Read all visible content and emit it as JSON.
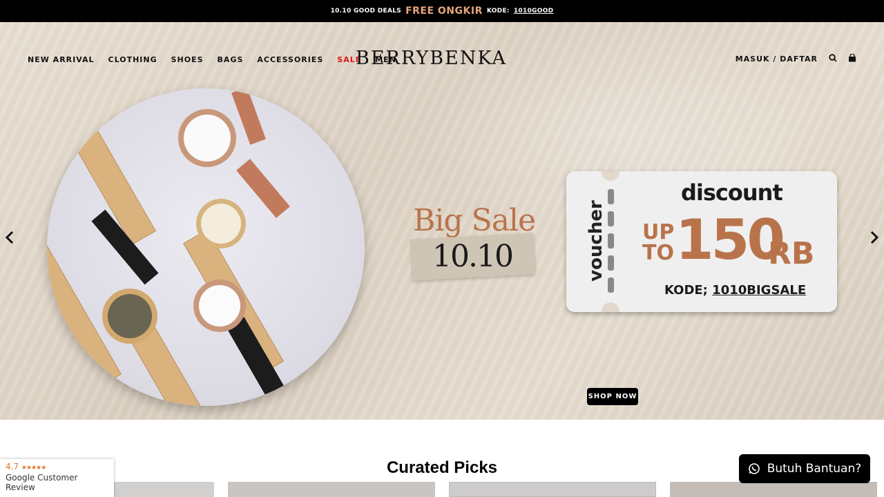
{
  "topbar": {
    "deals": "10.10 GOOD DEALS",
    "free": "FREE ONGKIR",
    "kode_label": "KODE:",
    "kode": "1010GOOD"
  },
  "nav": {
    "items": [
      "NEW ARRIVAL",
      "CLOTHING",
      "SHOES",
      "BAGS",
      "ACCESSORIES",
      "SALE",
      "MEN"
    ]
  },
  "logo": "BERRYBENKA",
  "account": {
    "login": "MASUK / DAFTAR"
  },
  "hero": {
    "big_sale": "Big Sale",
    "date": "10.10",
    "voucher": {
      "label": "voucher",
      "discount": "discount",
      "upto": "UP TO",
      "amount": "150",
      "unit": "RB",
      "kode_label": "KODE;",
      "kode": "1010BIGSALE"
    },
    "cta": "SHOP NOW"
  },
  "section": {
    "title": "Curated Picks"
  },
  "review": {
    "rating": "4.7",
    "stars": "★★★★★",
    "label": "Google Customer Review"
  },
  "help": {
    "label": "Butuh Bantuan?"
  },
  "colors": {
    "accent": "#b9734b",
    "sale": "#e0151b",
    "topbar": "#000000"
  }
}
